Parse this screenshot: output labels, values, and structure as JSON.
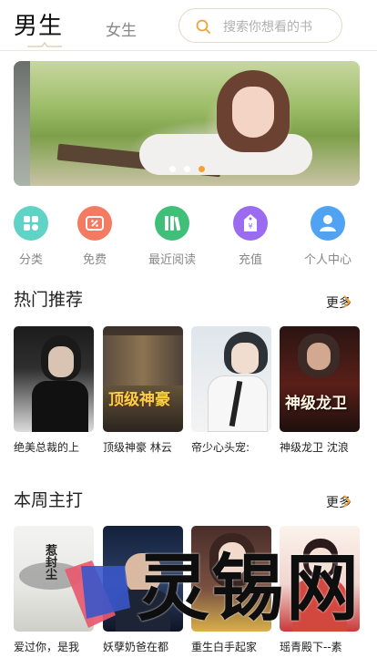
{
  "header": {
    "tab_male": "男生",
    "tab_female": "女生",
    "search_placeholder": "搜索你想看的书",
    "border_color": "#eee6d8"
  },
  "banner": {
    "dot_count": 3,
    "active_dot": 2,
    "active_dot_color": "#f1a23a"
  },
  "quick_menu": [
    {
      "label": "分类",
      "icon": "grid-icon",
      "color": "#5ed3c6"
    },
    {
      "label": "免费",
      "icon": "ticket-icon",
      "color": "#f27b62"
    },
    {
      "label": "最近阅读",
      "icon": "book-icon",
      "color": "#3fbf78"
    },
    {
      "label": "充值",
      "icon": "money-tag-icon",
      "color": "#9b6bf0"
    },
    {
      "label": "个人中心",
      "icon": "person-icon",
      "color": "#4fa3f2"
    }
  ],
  "sections": [
    {
      "title": "热门推荐",
      "more_label": "更多",
      "books": [
        {
          "title": "绝美总裁的上",
          "cover_text": ""
        },
        {
          "title": "顶级神豪 林云",
          "cover_text": "顶级神豪"
        },
        {
          "title": "帝少心头宠:",
          "cover_text": ""
        },
        {
          "title": "神级龙卫 沈浪",
          "cover_text": "神级龙卫"
        }
      ]
    },
    {
      "title": "本周主打",
      "more_label": "更多",
      "books": [
        {
          "title": "爱过你，是我",
          "cover_text": "惹封尘"
        },
        {
          "title": "妖孽奶爸在都",
          "cover_text": ""
        },
        {
          "title": "重生白手起家",
          "cover_text": ""
        },
        {
          "title": "瑶青殿下--素",
          "cover_text": ""
        }
      ]
    }
  ],
  "watermark": {
    "text": "灵锡网"
  },
  "colors": {
    "accent": "#f1a23a",
    "more_arrow": "#f1a23a"
  }
}
